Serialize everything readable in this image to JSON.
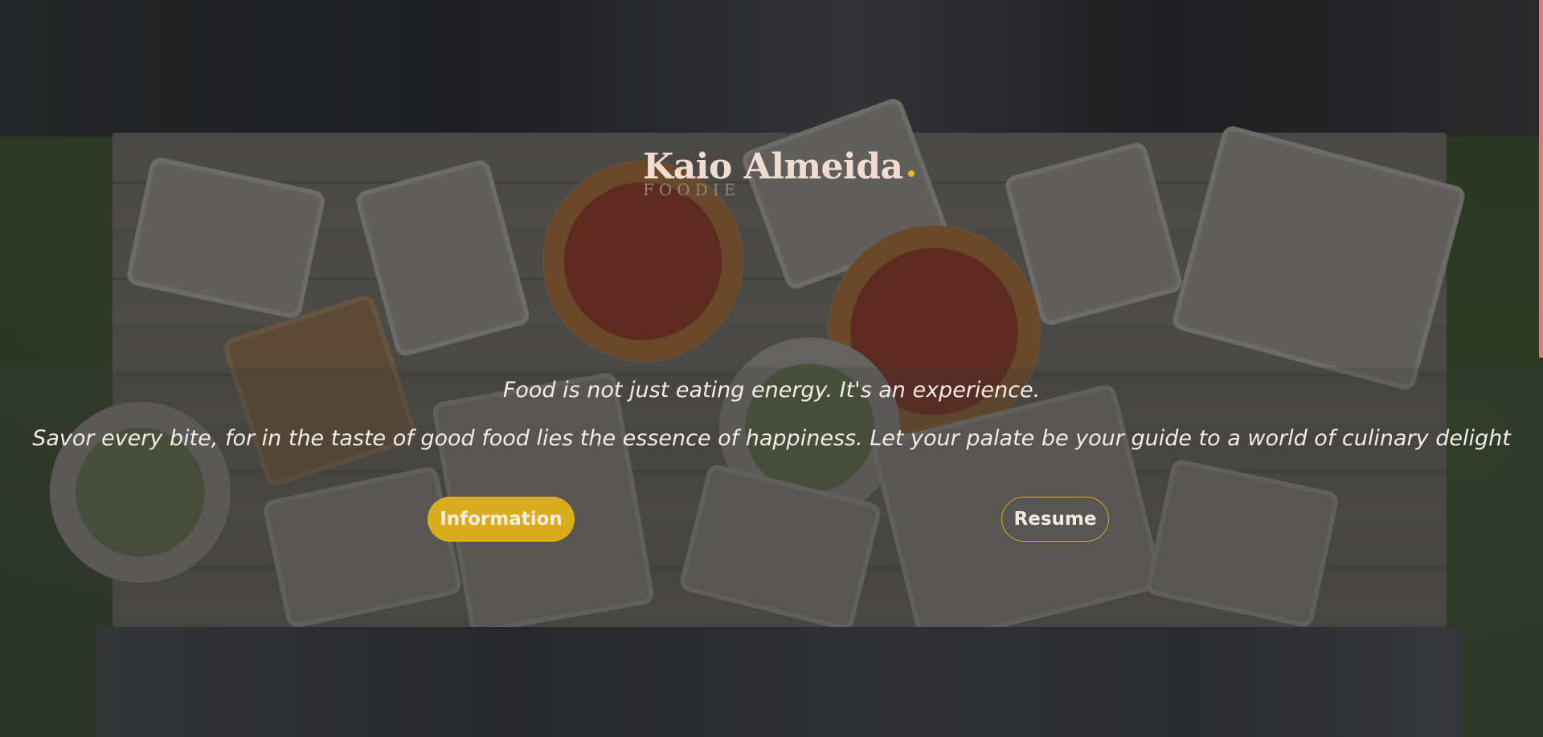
{
  "brand": {
    "name": "Kaio Almeida",
    "subtitle": "FOODIE",
    "accent_color": "#d9ad1d"
  },
  "hero": {
    "tagline_primary": "Food is not just eating energy. It's an experience.",
    "tagline_secondary": "Savor every bite, for in the taste of good food lies the essence of happiness. Let your palate be your guide to a world of culinary delight"
  },
  "actions": {
    "information_label": "Information",
    "resume_label": "Resume"
  },
  "background": {
    "description_icon": "food-table-photo"
  }
}
